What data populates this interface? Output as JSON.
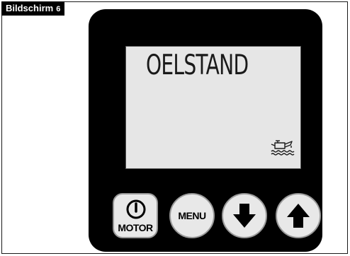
{
  "screen_tag": {
    "label": "Bildschirm",
    "number": "6"
  },
  "display": {
    "text": "OELSTAND",
    "icon": "oil-can-level-icon"
  },
  "buttons": {
    "motor": {
      "label": "MOTOR",
      "icon": "power-icon"
    },
    "menu": {
      "label": "MENU"
    },
    "down": {
      "icon": "arrow-down-icon"
    },
    "up": {
      "icon": "arrow-up-icon"
    }
  },
  "colors": {
    "device": "#000000",
    "lcd": "#e6e6e6",
    "button": "#e8e8e8"
  }
}
